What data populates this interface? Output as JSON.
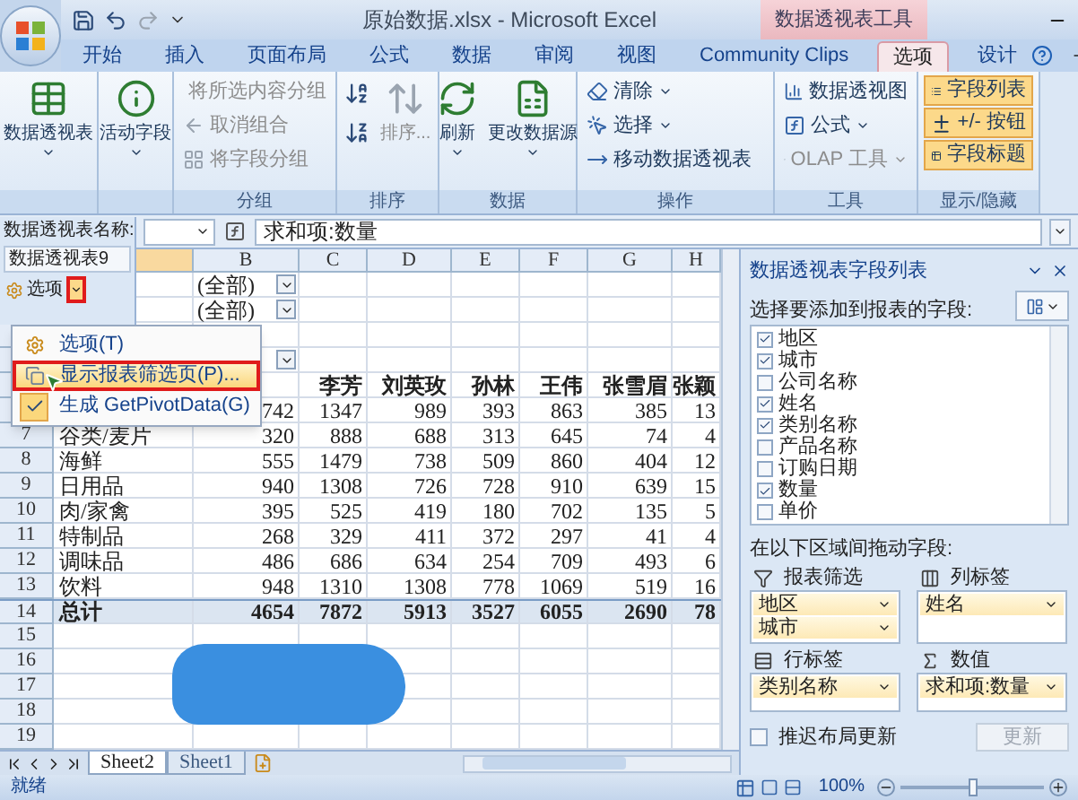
{
  "window": {
    "title": "原始数据.xlsx - Microsoft Excel",
    "context_title": "数据透视表工具"
  },
  "tabs": [
    {
      "label": "开始",
      "selected": false
    },
    {
      "label": "插入",
      "selected": false
    },
    {
      "label": "页面布局",
      "selected": false
    },
    {
      "label": "公式",
      "selected": false
    },
    {
      "label": "数据",
      "selected": false
    },
    {
      "label": "审阅",
      "selected": false
    },
    {
      "label": "视图",
      "selected": false
    },
    {
      "label": "Community Clips",
      "selected": false
    },
    {
      "label": "选项",
      "selected": true
    },
    {
      "label": "设计",
      "selected": false
    }
  ],
  "ribbon": {
    "groups": [
      {
        "items": [
          {
            "kind": "large",
            "label": "数据透视表",
            "dropdown": true,
            "disabled": false
          }
        ]
      },
      {
        "items": [
          {
            "kind": "large",
            "label": "活动字段",
            "dropdown": true,
            "disabled": false
          }
        ]
      },
      {
        "label": "分组",
        "items": [
          {
            "kind": "small",
            "label": "将所选内容分组",
            "dropdown": false,
            "disabled": true
          },
          {
            "kind": "small",
            "label": "取消组合",
            "dropdown": false,
            "disabled": true
          },
          {
            "kind": "small",
            "label": "将字段分组",
            "dropdown": false,
            "disabled": true
          }
        ]
      },
      {
        "label": "排序",
        "items": [
          {
            "kind": "sort_icons",
            "disabled": false
          },
          {
            "kind": "large",
            "label": "排序...",
            "dropdown": false,
            "disabled": true
          }
        ]
      },
      {
        "label": "数据",
        "items": [
          {
            "kind": "large",
            "label": "刷新",
            "dropdown": true,
            "disabled": false
          },
          {
            "kind": "large",
            "label": "更改数据源",
            "dropdown": true,
            "disabled": false
          }
        ]
      },
      {
        "label": "操作",
        "items": [
          {
            "kind": "small",
            "label": "清除",
            "dropdown": true,
            "disabled": false
          },
          {
            "kind": "small",
            "label": "选择",
            "dropdown": true,
            "disabled": false
          },
          {
            "kind": "small",
            "label": "移动数据透视表",
            "dropdown": false,
            "disabled": false
          }
        ]
      },
      {
        "label": "工具",
        "items": [
          {
            "kind": "small",
            "label": "数据透视图",
            "dropdown": false,
            "disabled": false
          },
          {
            "kind": "small",
            "label": "公式",
            "dropdown": true,
            "disabled": false
          },
          {
            "kind": "small",
            "label": "OLAP 工具",
            "dropdown": true,
            "disabled": true
          }
        ]
      },
      {
        "label": "显示/隐藏",
        "items": [
          {
            "kind": "toggle",
            "label": "字段列表",
            "on": true
          },
          {
            "kind": "toggle",
            "label": "+/- 按钮",
            "on": true
          },
          {
            "kind": "toggle",
            "label": "字段标题",
            "on": true
          }
        ]
      }
    ]
  },
  "sheet": {
    "formula": "求和项:数量",
    "columns": [
      "B",
      "C",
      "D",
      "E",
      "F",
      "G",
      "H"
    ],
    "rows": [
      {
        "kind": "filter",
        "value": "(全部)"
      },
      {
        "kind": "filter",
        "value": "(全部)"
      },
      {
        "kind": "empty"
      },
      {
        "kind": "filter"
      },
      {
        "kind": "header",
        "values": [
          "李芳",
          "刘英玫",
          "孙林",
          "王伟",
          "张雪眉",
          "张颖"
        ]
      },
      {
        "kind": "data",
        "values": [
          "742",
          "1347",
          "989",
          "393",
          "863",
          "385",
          "13"
        ]
      },
      {
        "kind": "data",
        "number": "7",
        "label": "谷类/麦片",
        "values": [
          "320",
          "888",
          "688",
          "313",
          "645",
          "74",
          "4"
        ]
      },
      {
        "kind": "data",
        "number": "8",
        "label": "海鲜",
        "values": [
          "555",
          "1479",
          "738",
          "509",
          "860",
          "404",
          "12"
        ]
      },
      {
        "kind": "data",
        "number": "9",
        "label": "日用品",
        "values": [
          "940",
          "1308",
          "726",
          "728",
          "910",
          "639",
          "15"
        ]
      },
      {
        "kind": "data",
        "number": "10",
        "label": "肉/家禽",
        "values": [
          "395",
          "525",
          "419",
          "180",
          "702",
          "135",
          "5"
        ]
      },
      {
        "kind": "data",
        "number": "11",
        "label": "特制品",
        "values": [
          "268",
          "329",
          "411",
          "372",
          "297",
          "41",
          "4"
        ]
      },
      {
        "kind": "data",
        "number": "12",
        "label": "调味品",
        "values": [
          "486",
          "686",
          "634",
          "254",
          "709",
          "493",
          "6"
        ]
      },
      {
        "kind": "data",
        "number": "13",
        "label": "饮料",
        "values": [
          "948",
          "1310",
          "1308",
          "778",
          "1069",
          "519",
          "16"
        ]
      },
      {
        "kind": "total",
        "number": "14",
        "label": "总计",
        "values": [
          "4654",
          "7872",
          "5913",
          "3527",
          "6055",
          "2690",
          "78"
        ]
      },
      {
        "kind": "empty",
        "number": "15"
      },
      {
        "kind": "empty",
        "number": "16"
      },
      {
        "kind": "empty",
        "number": "17"
      },
      {
        "kind": "empty",
        "number": "18"
      },
      {
        "kind": "empty",
        "number": "19"
      }
    ],
    "sheet_tabs": [
      {
        "label": "Sheet2",
        "selected": true
      },
      {
        "label": "Sheet1",
        "selected": false
      }
    ]
  },
  "pivot_name_panel": {
    "label": "数据透视表名称:",
    "value": "数据透视表9",
    "options_button": "选项",
    "caret_annotated": true
  },
  "options_menu": [
    {
      "label": "选项(T)",
      "highlighted": false,
      "annotated": false,
      "checked": false
    },
    {
      "label": "显示报表筛选页(P)...",
      "highlighted": true,
      "annotated": true,
      "checked": false
    },
    {
      "label": "生成 GetPivotData(G)",
      "highlighted": false,
      "annotated": false,
      "checked": true
    }
  ],
  "field_list": {
    "title": "数据透视表字段列表",
    "prompt": "选择要添加到报表的字段:",
    "fields": [
      {
        "label": "地区",
        "checked": true
      },
      {
        "label": "城市",
        "checked": true
      },
      {
        "label": "公司名称",
        "checked": false
      },
      {
        "label": "姓名",
        "checked": true
      },
      {
        "label": "类别名称",
        "checked": true
      },
      {
        "label": "产品名称",
        "checked": false
      },
      {
        "label": "订购日期",
        "checked": false
      },
      {
        "label": "数量",
        "checked": true
      },
      {
        "label": "单价",
        "checked": false
      }
    ],
    "drag_prompt": "在以下区域间拖动字段:",
    "areas": [
      {
        "kind": "filter",
        "label": "报表筛选",
        "items": [
          "地区",
          "城市"
        ]
      },
      {
        "kind": "columns",
        "label": "列标签",
        "items": [
          "姓名"
        ]
      },
      {
        "kind": "rows",
        "label": "行标签",
        "items": [
          "类别名称"
        ]
      },
      {
        "kind": "values",
        "label": "数值",
        "items": [
          "求和项:数量"
        ]
      }
    ],
    "defer": {
      "label": "推迟布局更新",
      "checked": false
    },
    "update_button": {
      "label": "更新",
      "disabled": true
    }
  },
  "status_bar": {
    "text": "就绪",
    "zoom": {
      "label": "100%",
      "level": 0.5
    }
  }
}
